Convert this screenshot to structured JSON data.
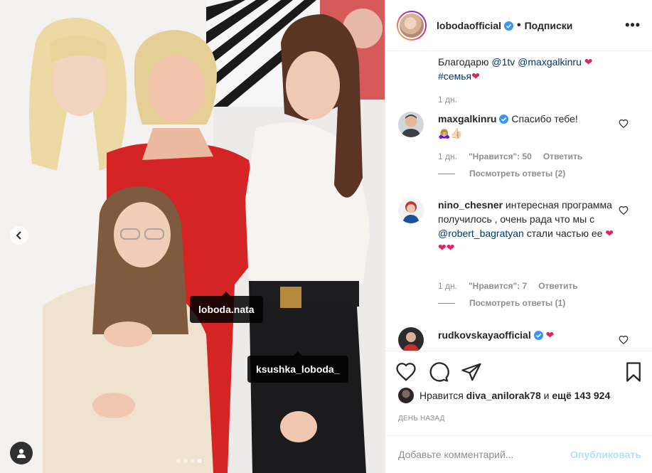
{
  "post": {
    "photo": {
      "tags": [
        "loboda.nata",
        "ksushka_loboda_"
      ],
      "carousel": {
        "count": 4,
        "active": 4
      }
    }
  },
  "header": {
    "username": "lobodaofficial",
    "separator": "•",
    "follow_label": "Подписки",
    "more_label": "•••"
  },
  "caption": {
    "text_prefix": "Благодарю ",
    "mention1": "@1tv",
    "mention2": "@maxgalkinru",
    "heart": "❤",
    "hashtag": "#семья",
    "time": "1 дн."
  },
  "comments": [
    {
      "username": "maxgalkinru",
      "text": "Спасибо тебе!",
      "emoji": "🙇🏼‍♀️👍🏻",
      "time": "1 дн.",
      "likes": "\"Нравится\": 50",
      "reply_label": "Ответить",
      "view_replies": "Посмотреть ответы (2)"
    },
    {
      "username": "nino_chesner",
      "text": "интересная программа получилось , очень рада что мы с",
      "mention": "@robert_bagratyan",
      "text_after": "стали частью ее",
      "hearts": "❤❤❤",
      "time": "1 дн.",
      "likes": "\"Нравится\": 7",
      "reply_label": "Ответить",
      "view_replies": "Посмотреть ответы (1)"
    },
    {
      "username": "rudkovskayaofficial",
      "heart": "❤"
    }
  ],
  "likes": {
    "prefix": "Нравится",
    "user": "diva_anilorak78",
    "and": "и",
    "count": "ещё 143 924"
  },
  "date_label": "ДЕНЬ НАЗАД",
  "add_comment": {
    "placeholder": "Добавьте комментарий...",
    "publish_label": "Опубликовать"
  },
  "colors": {
    "verified": "#3897f0",
    "link": "#00376b",
    "heart": "#e0245e",
    "publish_disabled": "#b2dffc"
  }
}
